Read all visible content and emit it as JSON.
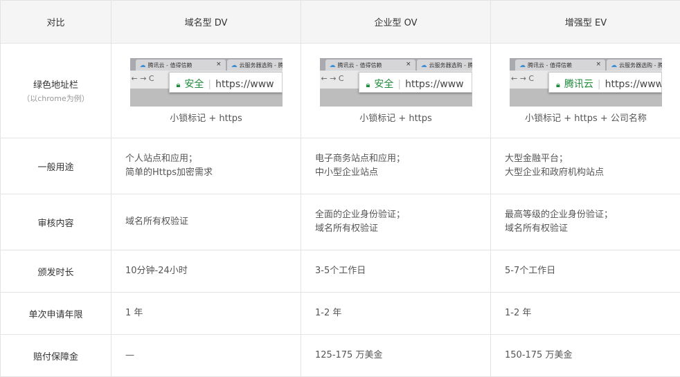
{
  "headers": [
    "对比",
    "域名型 DV",
    "企业型 OV",
    "增强型 EV"
  ],
  "browser_row": {
    "label": "绿色地址栏",
    "sublabel": "（以chrome为例）",
    "tab1": "腾讯云 - 值得信赖",
    "tab2": "云服务器选购 - 腾",
    "nav": "←  →  C",
    "url": "https://www",
    "cols": [
      {
        "security_text": "安全",
        "caption": "小锁标记 + https"
      },
      {
        "security_text": "安全",
        "caption": "小锁标记 + https"
      },
      {
        "security_text": "腾讯云",
        "caption": "小锁标记 + https + 公司名称"
      }
    ]
  },
  "rows": [
    {
      "label": "一般用途",
      "cells": [
        [
          "个人站点和应用；",
          "简单的Https加密需求"
        ],
        [
          "电子商务站点和应用；",
          "中小型企业站点"
        ],
        [
          "大型金融平台；",
          "大型企业和政府机构站点"
        ]
      ]
    },
    {
      "label": "审核内容",
      "cells": [
        [
          "域名所有权验证"
        ],
        [
          "全面的企业身份验证；",
          "域名所有权验证"
        ],
        [
          "最高等级的企业身份验证；",
          "域名所有权验证"
        ]
      ]
    },
    {
      "label": "颁发时长",
      "cells": [
        [
          "10分钟-24小时"
        ],
        [
          "3-5个工作日"
        ],
        [
          "5-7个工作日"
        ]
      ]
    },
    {
      "label": "单次申请年限",
      "cells": [
        [
          "1 年"
        ],
        [
          "1-2 年"
        ],
        [
          "1-2 年"
        ]
      ]
    },
    {
      "label": "赔付保障金",
      "cells": [
        [
          "—"
        ],
        [
          "125-175 万美金"
        ],
        [
          "150-175 万美金"
        ]
      ]
    }
  ]
}
